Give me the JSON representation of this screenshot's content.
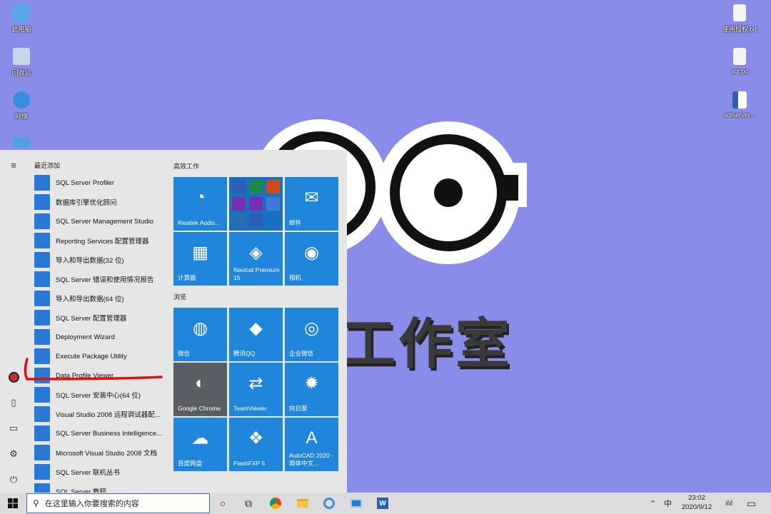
{
  "desktop": {
    "icons_left": [
      {
        "label": "此电脑",
        "color": "#5aa8e8"
      },
      {
        "label": "回收站",
        "color": "#c9d6e6"
      },
      {
        "label": "网络",
        "color": "#3a8ee0"
      },
      {
        "label": "",
        "color": "#4aa3e0"
      }
    ],
    "icons_right": [
      {
        "label": "使用授权.txt",
        "color": "#f5f5f5"
      },
      {
        "label": "sql.txt",
        "color": "#f5f5f5"
      },
      {
        "label": "sqlserver...",
        "color": "#2b5fb3"
      }
    ],
    "wallpaper_text": "工作室"
  },
  "start_menu": {
    "recent_header": "最近添加",
    "apps": [
      {
        "label": "SQL Server Profiler",
        "icon": "profiler-icon",
        "color": "#2a78d6"
      },
      {
        "label": "数据库引擎优化顾问",
        "icon": "tuning-advisor-icon",
        "color": "#2a78d6"
      },
      {
        "label": "SQL Server Management Studio",
        "icon": "ssms-icon",
        "color": "#2a78d6"
      },
      {
        "label": "Reporting Services 配置管理器",
        "icon": "reporting-icon",
        "color": "#2a78d6"
      },
      {
        "label": "导入和导出数据(32 位)",
        "icon": "import-export-icon",
        "color": "#2a78d6"
      },
      {
        "label": "SQL Server 错误和使用情况报告",
        "icon": "error-report-icon",
        "color": "#2a78d6"
      },
      {
        "label": "导入和导出数据(64 位)",
        "icon": "import-export-icon",
        "color": "#2a78d6"
      },
      {
        "label": "SQL Server 配置管理器",
        "icon": "config-manager-icon",
        "color": "#2a78d6"
      },
      {
        "label": "Deployment Wizard",
        "icon": "deployment-icon",
        "color": "#2a78d6"
      },
      {
        "label": "Execute Package Utility",
        "icon": "package-icon",
        "color": "#2a78d6"
      },
      {
        "label": "Data Profile Viewer",
        "icon": "profile-viewer-icon",
        "color": "#2a78d6"
      },
      {
        "label": "SQL Server 安装中心(64 位)",
        "icon": "install-center-icon",
        "color": "#2a78d6"
      },
      {
        "label": "Visual Studio 2008 远程调试器配...",
        "icon": "vs-debugger-icon",
        "color": "#2a78d6"
      },
      {
        "label": "SQL Server Business Intelligence...",
        "icon": "bi-icon",
        "color": "#2a78d6"
      },
      {
        "label": "Microsoft Visual Studio 2008 文档",
        "icon": "help-icon",
        "color": "#2a78d6"
      },
      {
        "label": "SQL Server 联机丛书",
        "icon": "help-icon",
        "color": "#2a78d6"
      },
      {
        "label": "SQL Server 教程",
        "icon": "tutorial-icon",
        "color": "#2a78d6"
      }
    ],
    "group_work": "高效工作",
    "group_browse": "浏览",
    "tiles": [
      {
        "label": "Realtek Audio...",
        "glyph": "◔",
        "grey": false
      },
      {
        "label": "",
        "glyph": "",
        "grey": false
      },
      {
        "label": "邮件",
        "glyph": "✉",
        "grey": false
      },
      {
        "label": "计算器",
        "glyph": "▦",
        "grey": false
      },
      {
        "label": "Navicat Premium 15",
        "glyph": "◈",
        "grey": false
      },
      {
        "label": "相机",
        "glyph": "◉",
        "grey": false
      },
      {
        "label": "微信",
        "glyph": "◍",
        "grey": false
      },
      {
        "label": "腾讯QQ",
        "glyph": "◆",
        "grey": false
      },
      {
        "label": "企业微信",
        "glyph": "◎",
        "grey": false
      },
      {
        "label": "Google Chrome",
        "glyph": "◐",
        "grey": true
      },
      {
        "label": "TeamViewer",
        "glyph": "⇄",
        "grey": false
      },
      {
        "label": "向日葵",
        "glyph": "✹",
        "grey": false
      },
      {
        "label": "百度网盘",
        "glyph": "☁",
        "grey": false
      },
      {
        "label": "FlashFXP 5",
        "glyph": "❖",
        "grey": false
      },
      {
        "label": "AutoCAD 2020 - 简体中文...",
        "glyph": "A",
        "grey": false
      }
    ]
  },
  "taskbar": {
    "search_placeholder": "在这里输入你要搜索的内容",
    "ime": "中",
    "time": "23:02",
    "date": "2020/9/12"
  }
}
